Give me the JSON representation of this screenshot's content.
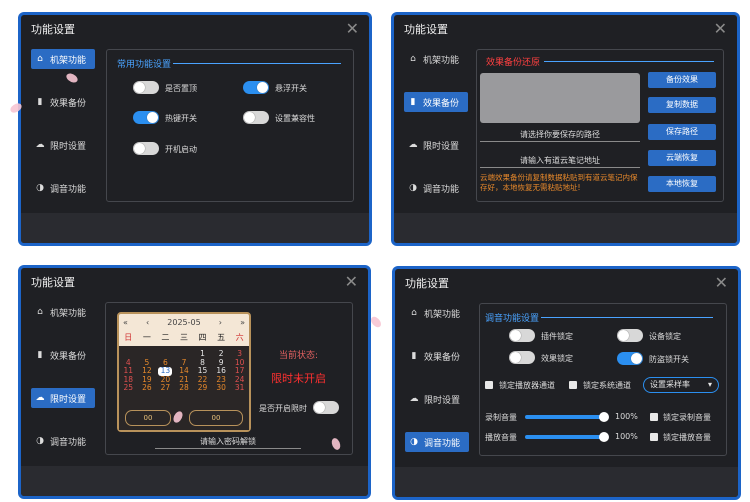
{
  "window_title": "功能设置",
  "nav": [
    {
      "icon": "home-icon",
      "glyph": "⌂",
      "label": "机架功能"
    },
    {
      "icon": "bar-chart-icon",
      "glyph": "▮",
      "label": "效果备份"
    },
    {
      "icon": "cloud-icon",
      "glyph": "☁",
      "label": "限时设置"
    },
    {
      "icon": "contrast-icon",
      "glyph": "◑",
      "label": "调音功能"
    }
  ],
  "panel1": {
    "section_title": "常用功能设置",
    "toggles": [
      {
        "label": "是否置顶",
        "on": false
      },
      {
        "label": "悬浮开关",
        "on": true
      },
      {
        "label": "热键开关",
        "on": true
      },
      {
        "label": "设置兼容性",
        "on": false
      },
      {
        "label": "开机启动",
        "on": false
      }
    ]
  },
  "panel2": {
    "section_title": "效果备份还原",
    "buttons": [
      "备份效果",
      "复制数据",
      "保存路径",
      "云端恢复",
      "本地恢复"
    ],
    "path_hint": "请选择你要保存的路径",
    "note_hint": "请输入有道云笔记地址",
    "tip": "云端效果备份请复制数据粘贴到有道云笔记内保存好，本地恢复无需粘贴地址!"
  },
  "panel3": {
    "calendar": {
      "prev_year": "«",
      "prev_month": "‹",
      "month": "2025-05",
      "next_month": "›",
      "next_year": "»",
      "weekdays": [
        "日",
        "一",
        "二",
        "三",
        "四",
        "五",
        "六"
      ],
      "rows": [
        [
          "",
          "",
          "",
          "",
          "1",
          "2",
          "3"
        ],
        [
          "4",
          "5",
          "6",
          "7",
          "8",
          "9",
          "10"
        ],
        [
          "11",
          "12",
          "13",
          "14",
          "15",
          "16",
          "17"
        ],
        [
          "18",
          "19",
          "20",
          "21",
          "22",
          "23",
          "24"
        ],
        [
          "25",
          "26",
          "27",
          "28",
          "29",
          "30",
          "31"
        ]
      ],
      "selected_day": "13",
      "time_a": "00",
      "time_b": "00"
    },
    "status_label": "当前状态:",
    "status_value": "限时未开启",
    "enable_label": "是否开启限时",
    "password_hint": "请输入密码解锁"
  },
  "panel4": {
    "section_title": "调音功能设置",
    "toggles": [
      {
        "label": "插件锁定",
        "on": false
      },
      {
        "label": "设备锁定",
        "on": false
      },
      {
        "label": "效果锁定",
        "on": false
      },
      {
        "label": "防盗锁开关",
        "on": true
      }
    ],
    "checks": [
      "锁定播放器通道",
      "锁定系统通道"
    ],
    "select_value": "设置采样率",
    "sliders": [
      {
        "label": "录制音量",
        "value": "100%",
        "fraction": 1.0,
        "check": "锁定录制音量"
      },
      {
        "label": "播放音量",
        "value": "100%",
        "fraction": 1.0,
        "check": "锁定播放音量"
      }
    ]
  },
  "colors": {
    "accent": "#2b6cc4",
    "toggle_on": "#2b8ff0",
    "warning": "#e8892b",
    "danger": "#ff4040"
  }
}
